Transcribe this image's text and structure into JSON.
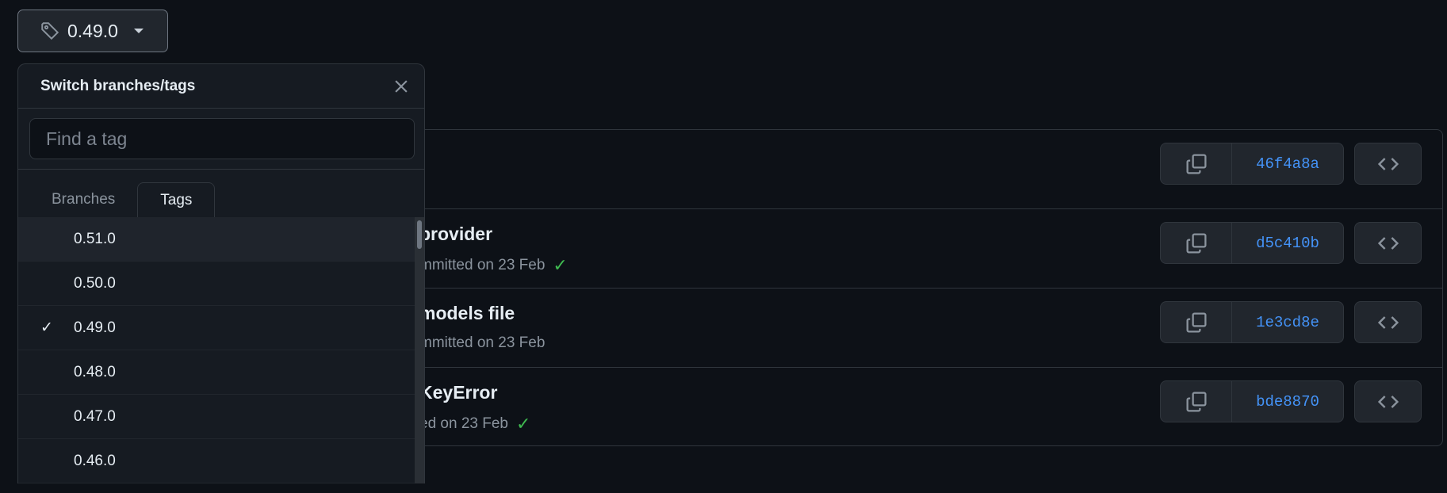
{
  "ref_button": {
    "label": "0.49.0",
    "icon": "tag-icon"
  },
  "dropdown": {
    "title": "Switch branches/tags",
    "search_placeholder": "Find a tag",
    "tabs": [
      "Branches",
      "Tags"
    ],
    "active_tab": "Tags",
    "items": [
      {
        "label": "0.51.0",
        "selected": false
      },
      {
        "label": "0.50.0",
        "selected": false
      },
      {
        "label": "0.49.0",
        "selected": true,
        "check": "✓"
      },
      {
        "label": "0.48.0",
        "selected": false
      },
      {
        "label": "0.47.0",
        "selected": false
      },
      {
        "label": "0.46.0",
        "selected": false
      }
    ]
  },
  "commits": [
    {
      "title": "",
      "meta": "",
      "hash": "46f4a8a",
      "check": false
    },
    {
      "title": "provider",
      "meta": "mmitted on 23 Feb",
      "hash": "d5c410b",
      "check": true
    },
    {
      "title": "models file",
      "meta": "mmitted on 23 Feb",
      "hash": "1e3cd8e",
      "check": false
    },
    {
      "title": "KeyError",
      "meta": "ed on 23 Feb",
      "hash": "bde8870",
      "check": true
    }
  ],
  "colors": {
    "bg": "#0d1117",
    "link": "#4493f8",
    "success": "#3fb950"
  }
}
